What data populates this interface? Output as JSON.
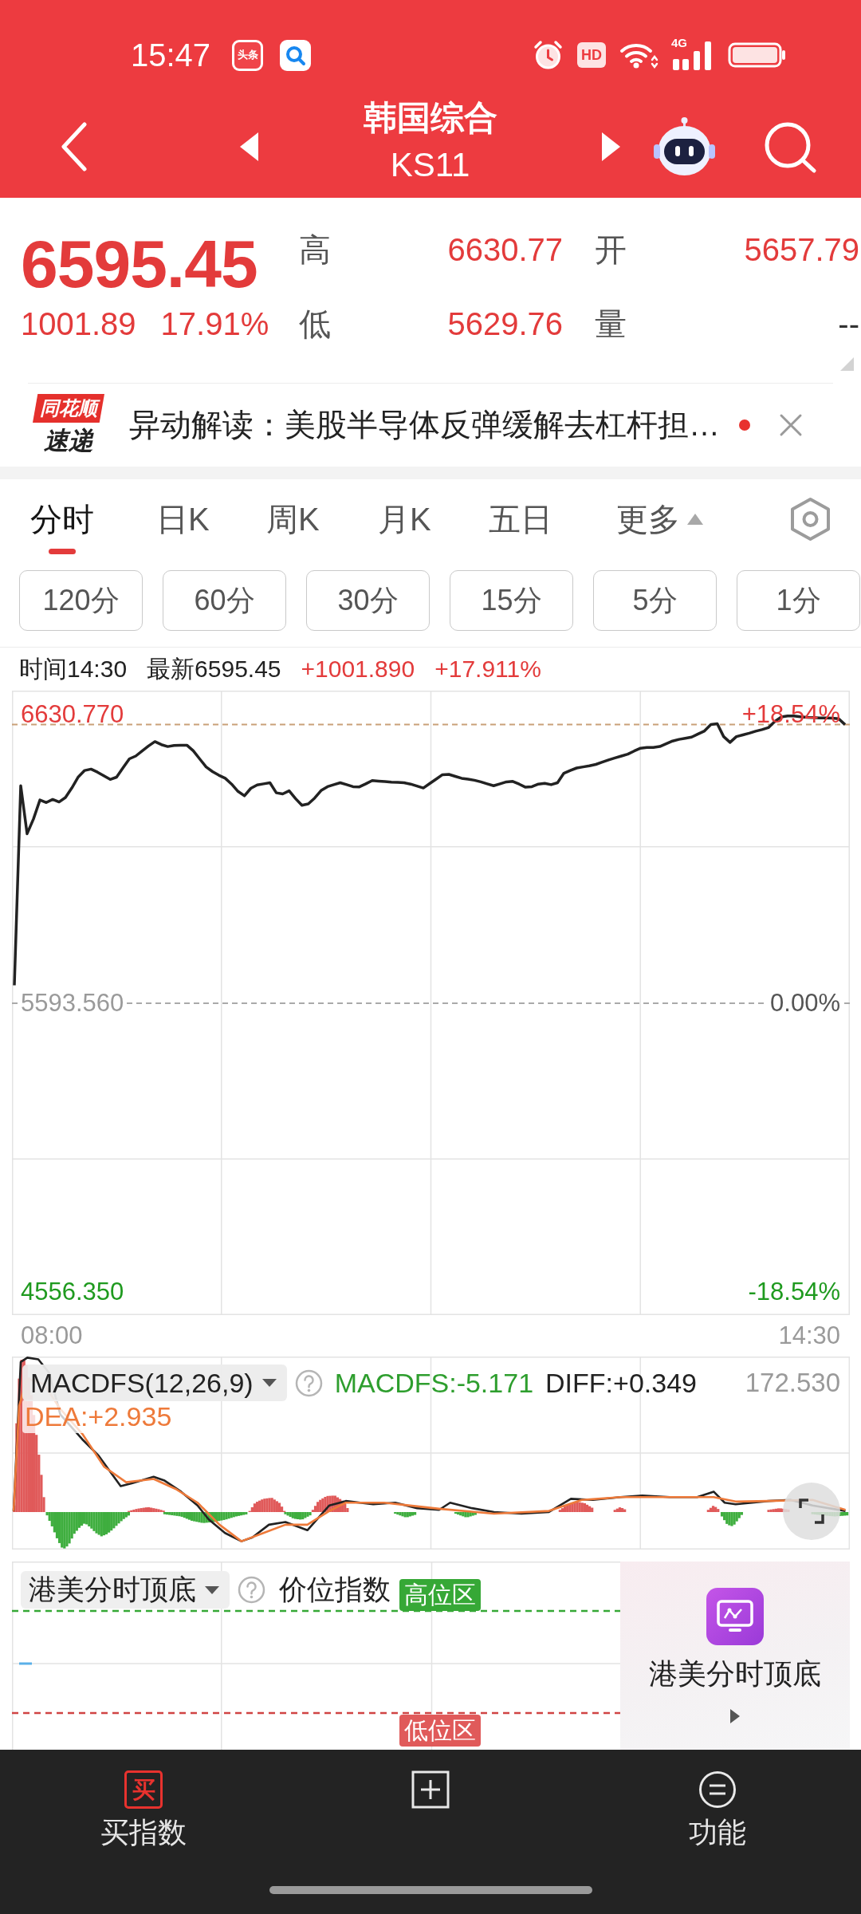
{
  "status_bar": {
    "time": "15:47",
    "notifications": [
      {
        "kind": "app",
        "text": "头条"
      },
      {
        "kind": "search"
      }
    ],
    "hd": "HD",
    "network": "4G"
  },
  "header": {
    "title": "韩国综合",
    "code": "KS11"
  },
  "quote": {
    "price": "6595.45",
    "change": "1001.89",
    "percent": "17.91%",
    "stats": [
      {
        "label": "高",
        "value": "6630.77",
        "color": "#e33b3b"
      },
      {
        "label": "开",
        "value": "5657.79",
        "color": "#e33b3b"
      },
      {
        "label": "低",
        "value": "5629.76",
        "color": "#e33b3b"
      },
      {
        "label": "量",
        "value": "--",
        "color": "#333333"
      }
    ]
  },
  "news": {
    "source": "同花顺",
    "source_caption": "速递",
    "text": "异动解读：美股半导体反弹缓解去杠杆担…",
    "unread": true
  },
  "tabs": [
    {
      "label": "分时",
      "kind": "tab",
      "selected": true
    },
    {
      "label": "日K",
      "kind": "tab",
      "selected": false
    },
    {
      "label": "周K",
      "kind": "tab",
      "selected": false
    },
    {
      "label": "月K",
      "kind": "tab",
      "selected": false
    },
    {
      "label": "五日",
      "kind": "tab",
      "selected": false
    },
    {
      "label": "更多",
      "kind": "menu",
      "selected": false
    }
  ],
  "periods": [
    {
      "label": "120分",
      "selected": false
    },
    {
      "label": "60分",
      "selected": false
    },
    {
      "label": "30分",
      "selected": false
    },
    {
      "label": "15分",
      "selected": false
    },
    {
      "label": "5分",
      "selected": false
    },
    {
      "label": "1分",
      "selected": false
    }
  ],
  "price_chart": {
    "readouts": [
      {
        "text": "时间14:30",
        "color": "#222222"
      },
      {
        "text": "最新6595.45",
        "color": "#222222"
      },
      {
        "text": "+1001.890",
        "color": "#e33b3b"
      },
      {
        "text": "+17.911%",
        "color": "#e33b3b"
      }
    ],
    "right_labels": [
      {
        "text": "+18.54%",
        "color": "#e33b3b"
      },
      {
        "text": "0.00%",
        "color": "#555555"
      },
      {
        "text": "-18.54%",
        "color": "#1f9a1f"
      }
    ],
    "time_labels": [
      "08:00",
      "14:30"
    ],
    "chart_data": {
      "type": "line",
      "ylim": [
        4473,
        6717
      ],
      "yticks": [
        {
          "value": 4556.35,
          "label": "4556.350"
        },
        {
          "value": 5593.56,
          "label": "5593.560"
        },
        {
          "value": 6630.77,
          "label": "6630.770"
        }
      ],
      "ref_lines": [
        {
          "axis": "y",
          "value": 5593.56,
          "color": "#a9a9a9"
        },
        {
          "axis": "y",
          "value": 6595.45,
          "color": "#c9a078"
        }
      ],
      "series": [
        {
          "color": "#222222",
          "values": [
            5658,
            6375,
            6203,
            6256,
            6324,
            6315,
            6326,
            6317,
            6333,
            6367,
            6407,
            6430,
            6435,
            6424,
            6411,
            6398,
            6406,
            6440,
            6472,
            6482,
            6500,
            6518,
            6534,
            6523,
            6516,
            6520,
            6521,
            6521,
            6501,
            6472,
            6443,
            6426,
            6413,
            6402,
            6381,
            6355,
            6339,
            6366,
            6378,
            6382,
            6386,
            6350,
            6346,
            6357,
            6329,
            6305,
            6310,
            6331,
            6358,
            6372,
            6379,
            6386,
            6379,
            6372,
            6371,
            6382,
            6394,
            6392,
            6390,
            6388,
            6387,
            6386,
            6381,
            6374,
            6367,
            6383,
            6399,
            6415,
            6416,
            6409,
            6402,
            6399,
            6395,
            6389,
            6382,
            6375,
            6382,
            6389,
            6391,
            6381,
            6370,
            6372,
            6381,
            6384,
            6379,
            6386,
            6420,
            6430,
            6439,
            6443,
            6447,
            6452,
            6460,
            6468,
            6475,
            6482,
            6489,
            6500,
            6510,
            6513,
            6513,
            6516,
            6526,
            6536,
            6542,
            6546,
            6550,
            6561,
            6572,
            6595,
            6598,
            6552,
            6531,
            6552,
            6558,
            6564,
            6571,
            6577,
            6584,
            6606,
            6622,
            6626,
            6626,
            6623,
            6621,
            6620,
            6619,
            6619,
            6618,
            6616,
            6595
          ]
        }
      ]
    }
  },
  "macd": {
    "indicator": "MACDFS(12,26,9)",
    "readouts": [
      {
        "kind": "macd",
        "text": "MACDFS:-5.171",
        "color": "#2e9e2e"
      },
      {
        "kind": "diff",
        "text": "DIFF:+0.349",
        "color": "#222222"
      },
      {
        "kind": "dea",
        "text": "DEA:+2.935",
        "color": "#ee7a3a"
      }
    ],
    "scale": "172.530"
  },
  "indicator": {
    "name": "港美分时顶底",
    "subtitle": "价位指数",
    "high_zone": "高位区",
    "low_zone": "低位区",
    "promo_title": "港美分时顶底"
  },
  "bottom_nav": [
    {
      "kind": "buy",
      "badge": "买",
      "label": "买指数"
    },
    {
      "kind": "add"
    },
    {
      "kind": "function",
      "label": "功能"
    }
  ]
}
